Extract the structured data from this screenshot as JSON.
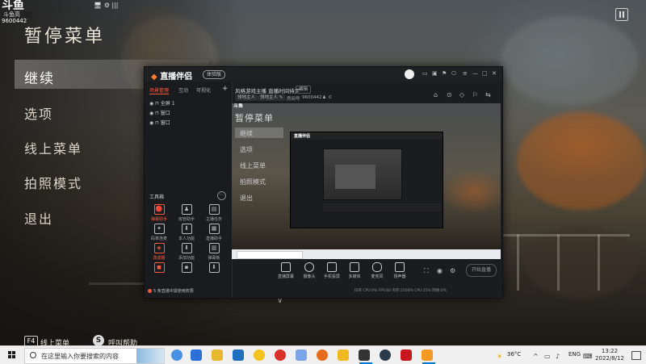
{
  "game": {
    "logo_main": "斗鱼",
    "logo_sub": "斗鱼高",
    "logo_num": "9600442",
    "menu_title": "暂停菜单",
    "menu_items": [
      "继续",
      "选项",
      "线上菜单",
      "拍照模式",
      "退出"
    ],
    "hints": [
      {
        "key": "F4",
        "label": "线上菜单"
      },
      {
        "key": "S",
        "label": "呼叫帮助"
      }
    ],
    "top_icons": "🖥 ⚙ |||",
    "chevron": "∨"
  },
  "app": {
    "logo": "直播伴侣",
    "badge": "体验版",
    "window_controls": [
      "≡",
      "—",
      "□",
      "✕"
    ],
    "title_icons": [
      "▭",
      "▣",
      "⚑",
      "⎔"
    ],
    "tabs": [
      "场景管理",
      "互动",
      "可视化"
    ],
    "add_icon": "+",
    "scenes": [
      {
        "name": "全屏 1"
      },
      {
        "name": "窗口"
      },
      {
        "name": "窗口"
      }
    ],
    "tools_title": "工具箱",
    "tools_more": "⋯",
    "tools": [
      {
        "icon": "🔴",
        "label": "弹幕助手",
        "hot": true
      },
      {
        "icon": "♟",
        "label": "房管助手",
        "hot": false
      },
      {
        "icon": "▤",
        "label": "主播任务",
        "hot": false
      },
      {
        "icon": "✦",
        "label": "码率连麦",
        "hot": false
      },
      {
        "icon": "⬇",
        "label": "本人功能",
        "hot": false
      },
      {
        "icon": "▦",
        "label": "直播助手",
        "hot": false
      },
      {
        "icon": "◈",
        "label": "改成摄",
        "hot": true
      },
      {
        "icon": "⬇",
        "label": "添加功能",
        "hot": false
      },
      {
        "icon": "▥",
        "label": "弹幕板",
        "hot": false
      },
      {
        "icon": "◼",
        "label": "",
        "hot": true
      },
      {
        "icon": "▪",
        "label": "",
        "hot": false
      },
      {
        "icon": "⬇",
        "label": "",
        "hot": false
      }
    ],
    "footer": "5 条直播中需使用权限",
    "stream_title": "风格游戏主播 直播时间待定",
    "edit_btn": "编辑",
    "tags": [
      "领地主人",
      "领地主人 ✎"
    ],
    "room_label": "房间号",
    "room_id": "9600442",
    "viewer_count": "0",
    "right_tools": [
      "⌂",
      "⊙",
      "◇",
      "⚐",
      "⇆"
    ],
    "preview": {
      "logo": "斗鱼",
      "title": "暂停菜单",
      "items": [
        "继续",
        "选项",
        "线上菜单",
        "拍照模式",
        "退出"
      ],
      "nested_logo": "直播伴侣"
    },
    "controls": [
      {
        "label": "直播屏幕"
      },
      {
        "label": "摄像头"
      },
      {
        "label": "手机投屏"
      },
      {
        "label": "多媒体"
      },
      {
        "label": "麦克风"
      },
      {
        "label": "扬声器"
      }
    ],
    "control_icons": [
      "⛶",
      "◉",
      "⚙"
    ],
    "start_label": "开始直播",
    "stats": "码率 CPU:9%   FPS:60   内存:2500%  CPU:25%   网络:0%"
  },
  "taskbar": {
    "search_placeholder": "在这里输入你要搜索的内容",
    "weather": "36°C",
    "tray": "ENG",
    "time": "13:22",
    "date": "2022/8/12",
    "tray_icons": [
      "^",
      "▭",
      "♪"
    ]
  },
  "colors": {
    "accent": "#ff5a3c",
    "taskbar_bg": "#f0f0f0",
    "app_bg": "#1b1c20"
  }
}
